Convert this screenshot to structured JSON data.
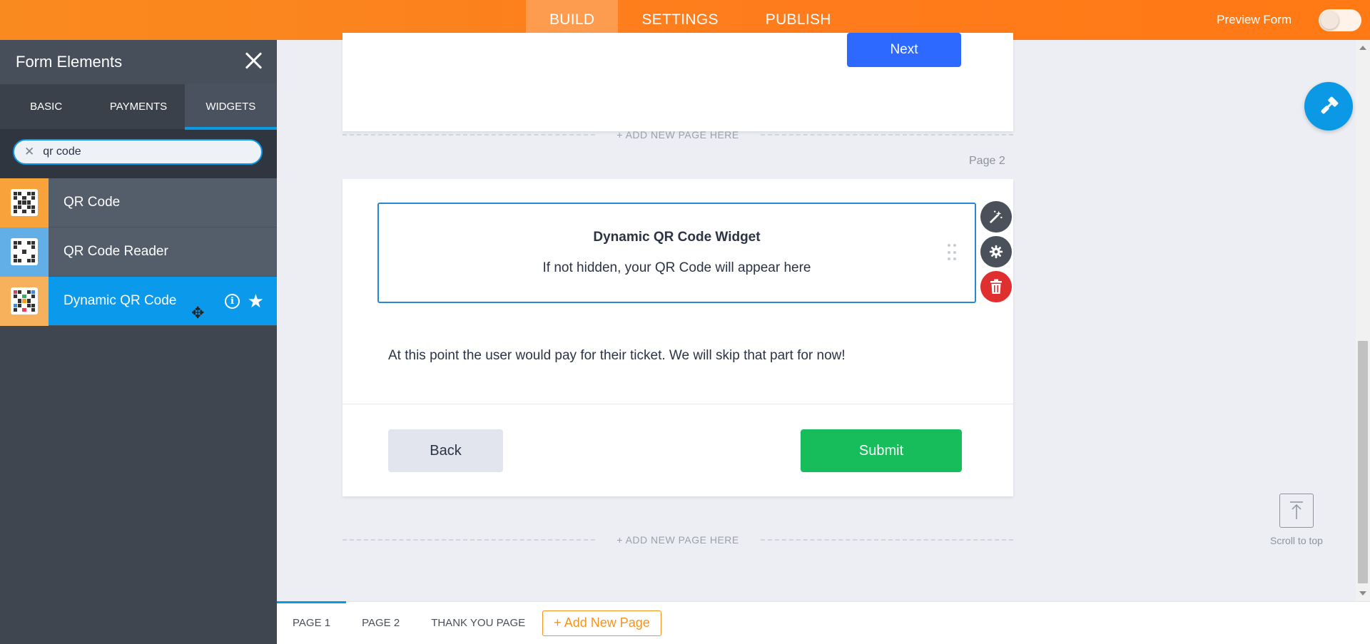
{
  "topbar": {
    "tabs": [
      {
        "label": "BUILD",
        "active": true
      },
      {
        "label": "SETTINGS",
        "active": false
      },
      {
        "label": "PUBLISH",
        "active": false
      }
    ],
    "preview_label": "Preview Form"
  },
  "sidebar": {
    "title": "Form Elements",
    "tabs": [
      {
        "label": "BASIC",
        "active": false
      },
      {
        "label": "PAYMENTS",
        "active": false
      },
      {
        "label": "WIDGETS",
        "active": true
      }
    ],
    "search": {
      "value": "qr code"
    },
    "items": [
      {
        "label": "QR Code",
        "icon": "qr-code-icon",
        "active": false
      },
      {
        "label": "QR Code Reader",
        "icon": "qr-code-reader-icon",
        "active": false
      },
      {
        "label": "Dynamic QR Code",
        "icon": "dynamic-qr-code-icon",
        "active": true
      }
    ]
  },
  "form": {
    "page1": {
      "next_label": "Next"
    },
    "add_page_label": "+ ADD NEW PAGE HERE",
    "page2": {
      "label": "Page 2",
      "widget": {
        "title": "Dynamic QR Code Widget",
        "subtitle": "If not hidden, your QR Code will appear here"
      },
      "text": "At this point the user would pay for their ticket. We will skip that part for now!",
      "back_label": "Back",
      "submit_label": "Submit"
    }
  },
  "scroll_top_label": "Scroll to top",
  "pagebar": {
    "tabs": [
      {
        "label": "PAGE 1",
        "active": true
      },
      {
        "label": "PAGE 2",
        "active": false
      },
      {
        "label": "THANK YOU PAGE",
        "active": false
      }
    ],
    "add_label": "+ Add New Page"
  },
  "colors": {
    "brand_orange": "#ff7b1c",
    "accent_blue": "#0b99e6",
    "next_blue": "#2e69ff",
    "submit_green": "#18bd5b",
    "delete_red": "#e02f2f"
  }
}
